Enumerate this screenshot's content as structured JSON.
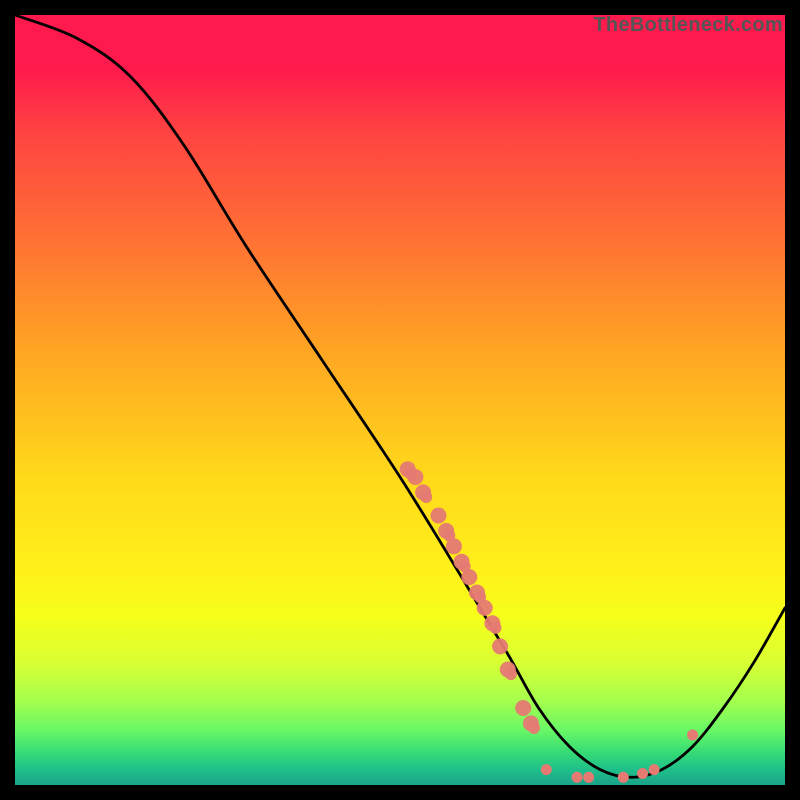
{
  "watermark": "TheBottleneck.com",
  "chart_data": {
    "type": "line",
    "title": "",
    "xlabel": "",
    "ylabel": "",
    "xlim": [
      0,
      100
    ],
    "ylim": [
      0,
      100
    ],
    "curve": [
      {
        "x": 0,
        "y": 100
      },
      {
        "x": 8,
        "y": 97
      },
      {
        "x": 15,
        "y": 92
      },
      {
        "x": 22,
        "y": 83
      },
      {
        "x": 30,
        "y": 70
      },
      {
        "x": 40,
        "y": 55
      },
      {
        "x": 50,
        "y": 40
      },
      {
        "x": 58,
        "y": 27
      },
      {
        "x": 64,
        "y": 17
      },
      {
        "x": 68,
        "y": 10
      },
      {
        "x": 72,
        "y": 5
      },
      {
        "x": 76,
        "y": 2
      },
      {
        "x": 80,
        "y": 1
      },
      {
        "x": 84,
        "y": 2
      },
      {
        "x": 88,
        "y": 5
      },
      {
        "x": 92,
        "y": 10
      },
      {
        "x": 96,
        "y": 16
      },
      {
        "x": 100,
        "y": 23
      }
    ],
    "markers_small": [
      {
        "x": 69.0,
        "y": 2.0
      },
      {
        "x": 73.0,
        "y": 1.0
      },
      {
        "x": 74.5,
        "y": 1.0
      },
      {
        "x": 79.0,
        "y": 1.0
      },
      {
        "x": 81.5,
        "y": 1.5
      },
      {
        "x": 83.0,
        "y": 2.0
      },
      {
        "x": 88.0,
        "y": 6.5
      }
    ],
    "markers_cluster": [
      {
        "x": 51.0,
        "y": 41.0
      },
      {
        "x": 52.0,
        "y": 40.0
      },
      {
        "x": 53.0,
        "y": 38.0
      },
      {
        "x": 55.0,
        "y": 35.0
      },
      {
        "x": 56.0,
        "y": 33.0
      },
      {
        "x": 57.0,
        "y": 31.0
      },
      {
        "x": 58.0,
        "y": 29.0
      },
      {
        "x": 59.0,
        "y": 27.0
      },
      {
        "x": 60.0,
        "y": 25.0
      },
      {
        "x": 61.0,
        "y": 23.0
      },
      {
        "x": 62.0,
        "y": 21.0
      },
      {
        "x": 63.0,
        "y": 18.0
      },
      {
        "x": 64.0,
        "y": 15.0
      },
      {
        "x": 66.0,
        "y": 10.0
      },
      {
        "x": 67.0,
        "y": 8.0
      }
    ]
  }
}
